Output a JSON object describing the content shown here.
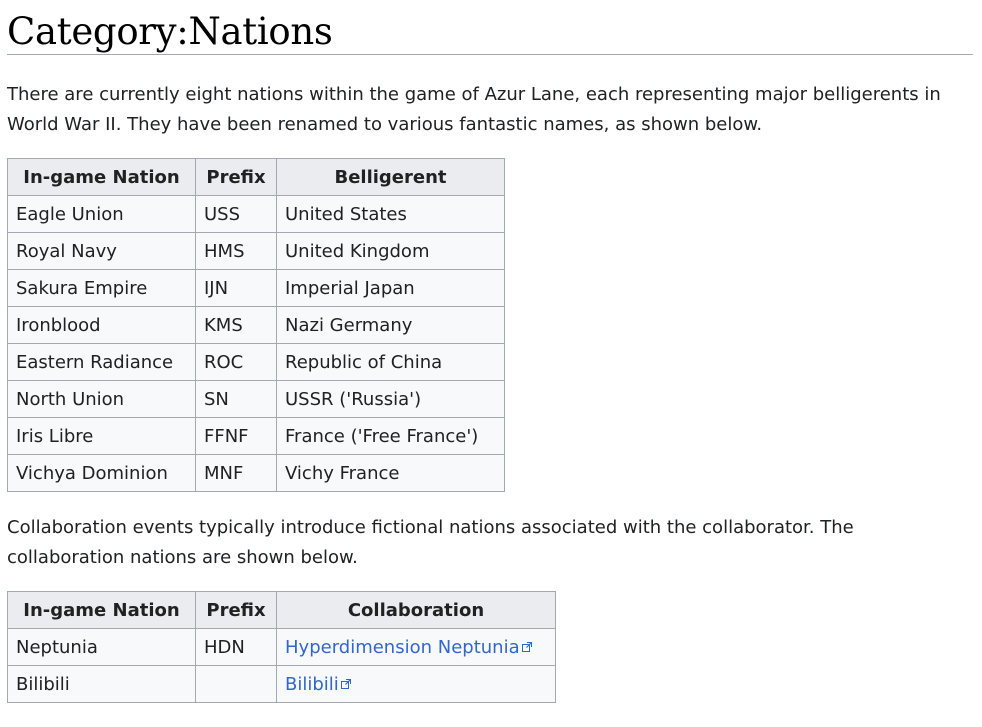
{
  "page": {
    "title": "Category:Nations",
    "intro": "There are currently eight nations within the game of Azur Lane, each representing major belligerents in World War II. They have been renamed to various fantastic names, as shown below.",
    "collab_intro": "Collaboration events typically introduce fictional nations associated with the collaborator. The collaboration nations are shown below."
  },
  "nations_table": {
    "headers": [
      "In-game Nation",
      "Prefix",
      "Belligerent"
    ],
    "rows": [
      [
        "Eagle Union",
        "USS",
        "United States"
      ],
      [
        "Royal Navy",
        "HMS",
        "United Kingdom"
      ],
      [
        "Sakura Empire",
        "IJN",
        "Imperial Japan"
      ],
      [
        "Ironblood",
        "KMS",
        "Nazi Germany"
      ],
      [
        "Eastern Radiance",
        "ROC",
        "Republic of China"
      ],
      [
        "North Union",
        "SN",
        "USSR ('Russia')"
      ],
      [
        "Iris Libre",
        "FFNF",
        "France ('Free France')"
      ],
      [
        "Vichya Dominion",
        "MNF",
        "Vichy France"
      ]
    ]
  },
  "collab_table": {
    "headers": [
      "In-game Nation",
      "Prefix",
      "Collaboration"
    ],
    "rows": [
      [
        "Neptunia",
        "HDN",
        "Hyperdimension Neptunia"
      ],
      [
        "Bilibili",
        "",
        "Bilibili"
      ]
    ]
  },
  "colors": {
    "link": "#3366cc",
    "table_border": "#a2a9b1",
    "header_bg": "#eaecf0",
    "cell_bg": "#f8f9fa"
  },
  "icons": {
    "external_link": "external-link-icon"
  }
}
